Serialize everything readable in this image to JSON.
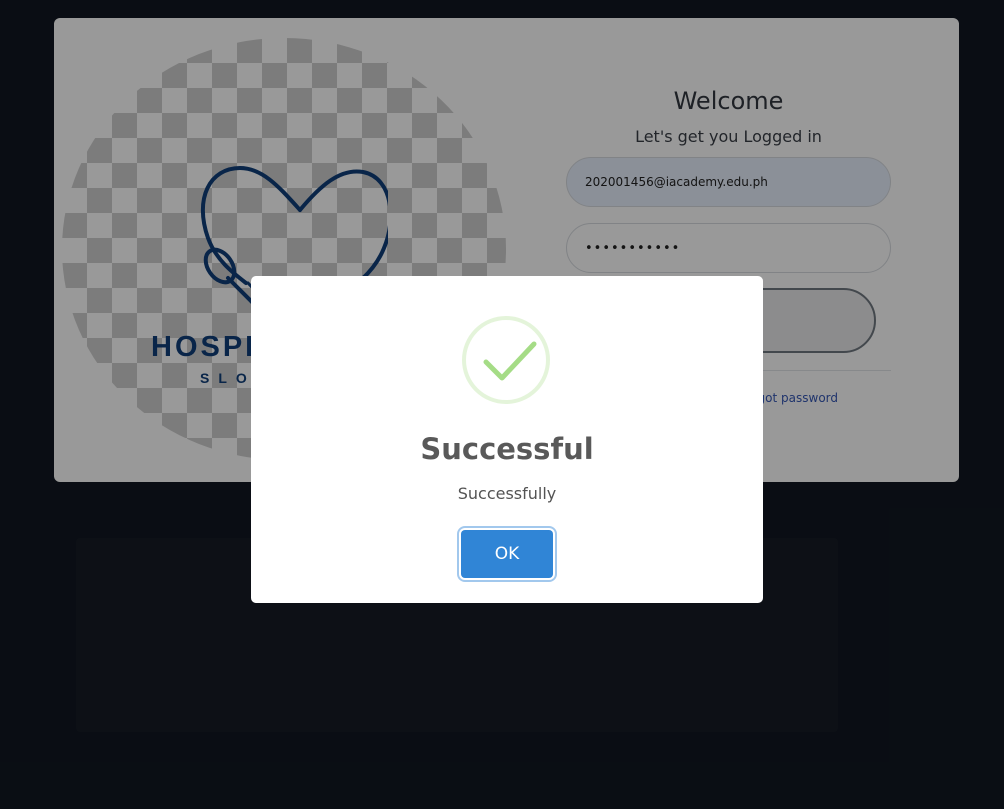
{
  "login": {
    "logo_name": "HOSPI",
    "logo_slogan": "SLOG",
    "welcome": "Welcome",
    "subtitle": "Let's get you Logged in",
    "email_value": "202001456@iacademy.edu.ph",
    "password_value": "•••••••••••",
    "forgot_password": "got password"
  },
  "modal": {
    "icon": "checkmark-icon",
    "title": "Successful",
    "message": "Successfully",
    "ok_label": "OK"
  },
  "colors": {
    "background": "#111722",
    "accent": "#3085d6",
    "success": "#a5dc86",
    "logo": "#0f3f7a"
  }
}
